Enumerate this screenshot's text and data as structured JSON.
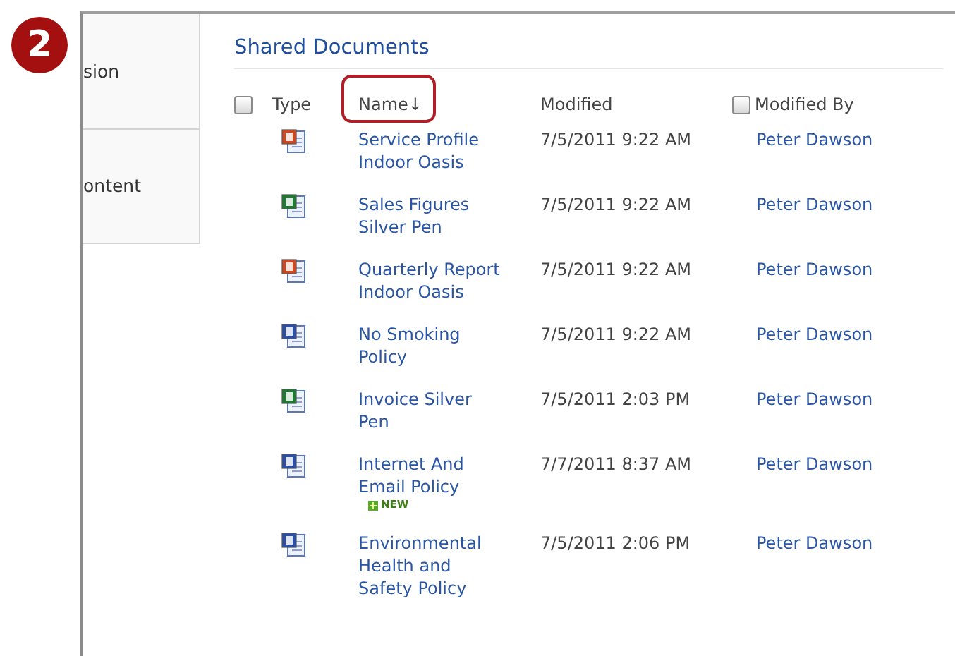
{
  "step_badge": "2",
  "nav": {
    "items": [
      "sion",
      "ontent"
    ]
  },
  "library": {
    "title": "Shared Documents",
    "select_all": {
      "checked": false
    },
    "columns": [
      {
        "label": "Type"
      },
      {
        "label": "Name↓",
        "highlighted": true
      },
      {
        "label": "Modified"
      },
      {
        "label": "Modified By",
        "checkbox": {
          "checked": false
        }
      }
    ],
    "rows": [
      {
        "kind": "powerpoint",
        "name": "Service Profile Indoor Oasis",
        "modified": "7/5/2011 9:22 AM",
        "modified_by": "Peter Dawson"
      },
      {
        "kind": "excel",
        "name": "Sales Figures Silver Pen",
        "modified": "7/5/2011 9:22 AM",
        "modified_by": "Peter Dawson"
      },
      {
        "kind": "powerpoint",
        "name": "Quarterly Report Indoor Oasis",
        "modified": "7/5/2011 9:22 AM",
        "modified_by": "Peter Dawson"
      },
      {
        "kind": "word",
        "name": "No Smoking Policy",
        "modified": "7/5/2011 9:22 AM",
        "modified_by": "Peter Dawson"
      },
      {
        "kind": "excel",
        "name": "Invoice Silver Pen",
        "modified": "7/5/2011 2:03 PM",
        "modified_by": "Peter Dawson"
      },
      {
        "kind": "word",
        "name": "Internet And Email Policy",
        "new_badge": "NEW",
        "modified": "7/7/2011 8:37 AM",
        "modified_by": "Peter Dawson"
      },
      {
        "kind": "word",
        "name": "Environmental Health and Safety Policy",
        "modified": "7/5/2011 2:06 PM",
        "modified_by": "Peter Dawson"
      }
    ]
  }
}
